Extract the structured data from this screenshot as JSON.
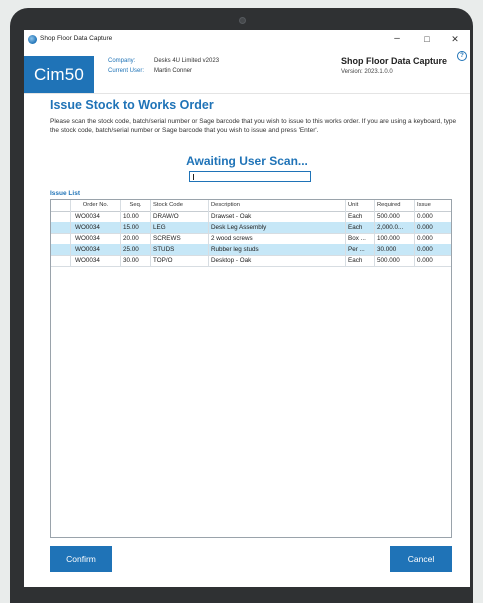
{
  "window": {
    "title": "Shop Floor Data Capture",
    "controls": {
      "minimize": "–",
      "maximize": "□",
      "close": "✕"
    },
    "help_icon": "question-icon"
  },
  "header": {
    "logo_text": "Cim50",
    "company_label": "Company:",
    "company_value": "Desks 4U Limited v2023",
    "user_label": "Current User:",
    "user_value": "Martin Conner",
    "app_title": "Shop Floor Data Capture",
    "app_version": "Version: 2023.1.0.0"
  },
  "main": {
    "heading": "Issue Stock to Works Order",
    "instructions": "Please scan the stock code, batch/serial number or Sage barcode that you wish to issue to this works order. If you are using a keyboard, type the stock code, batch/serial number or Sage barcode that you wish to issue and press 'Enter'.",
    "scan_status": "Awaiting User Scan...",
    "scan_value": "",
    "issue_list_label": "Issue List"
  },
  "table": {
    "columns": [
      "",
      "Order No.",
      "Seq.",
      "Stock Code",
      "Description",
      "Unit",
      "Required",
      "Issue"
    ],
    "rows": [
      {
        "order_no": "WO0034",
        "seq": "10.00",
        "stock_code": "DRAW/O",
        "description": "Drawset - Oak",
        "unit": "Each",
        "required": "500.000",
        "issue": "0.000"
      },
      {
        "order_no": "WO0034",
        "seq": "15.00",
        "stock_code": "LEG",
        "description": "Desk Leg Assembly",
        "unit": "Each",
        "required": "2,000.0...",
        "issue": "0.000"
      },
      {
        "order_no": "WO0034",
        "seq": "20.00",
        "stock_code": "SCREWS",
        "description": "2 wood screws",
        "unit": "Box ...",
        "required": "100.000",
        "issue": "0.000"
      },
      {
        "order_no": "WO0034",
        "seq": "25.00",
        "stock_code": "STUDS",
        "description": "Rubber leg studs",
        "unit": "Per ...",
        "required": "30.000",
        "issue": "0.000"
      },
      {
        "order_no": "WO0034",
        "seq": "30.00",
        "stock_code": "TOP/O",
        "description": "Desktop - Oak",
        "unit": "Each",
        "required": "500.000",
        "issue": "0.000"
      }
    ]
  },
  "footer": {
    "confirm_label": "Confirm",
    "cancel_label": "Cancel"
  },
  "colors": {
    "accent": "#1f73b7",
    "row_highlight": "#c6e7f7"
  }
}
